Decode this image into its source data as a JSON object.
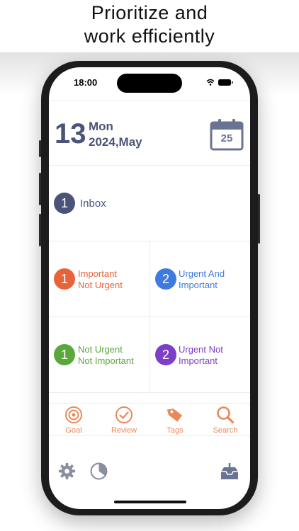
{
  "headline": {
    "line1": "Prioritize and",
    "line2": "work efficiently"
  },
  "status_bar": {
    "time": "18:00"
  },
  "date": {
    "day": "13",
    "weekday": "Mon",
    "year_month": "2024,May",
    "calendar_icon_day": "25"
  },
  "inbox": {
    "count": "1",
    "label": "Inbox",
    "color": "#4b5478"
  },
  "quadrants": [
    {
      "count": "1",
      "line1": "Important",
      "line2": "Not Urgent",
      "color": "#e8623a"
    },
    {
      "count": "2",
      "line1": "Urgent And",
      "line2": "Important",
      "color": "#3d7be0"
    },
    {
      "count": "1",
      "line1": "Not Urgent",
      "line2": "Not Important",
      "color": "#5aa83c"
    },
    {
      "count": "2",
      "line1": "Urgent Not",
      "line2": "Important",
      "color": "#7e3fc8"
    }
  ],
  "tabs": [
    {
      "label": "Goal",
      "icon": "target-icon"
    },
    {
      "label": "Review",
      "icon": "check-circle-icon"
    },
    {
      "label": "Tags",
      "icon": "tag-icon"
    },
    {
      "label": "Search",
      "icon": "search-icon"
    }
  ],
  "accent_color": "#e8895a",
  "footer_icons": [
    "gear-icon",
    "pie-chart-icon",
    "inbox-download-icon"
  ]
}
